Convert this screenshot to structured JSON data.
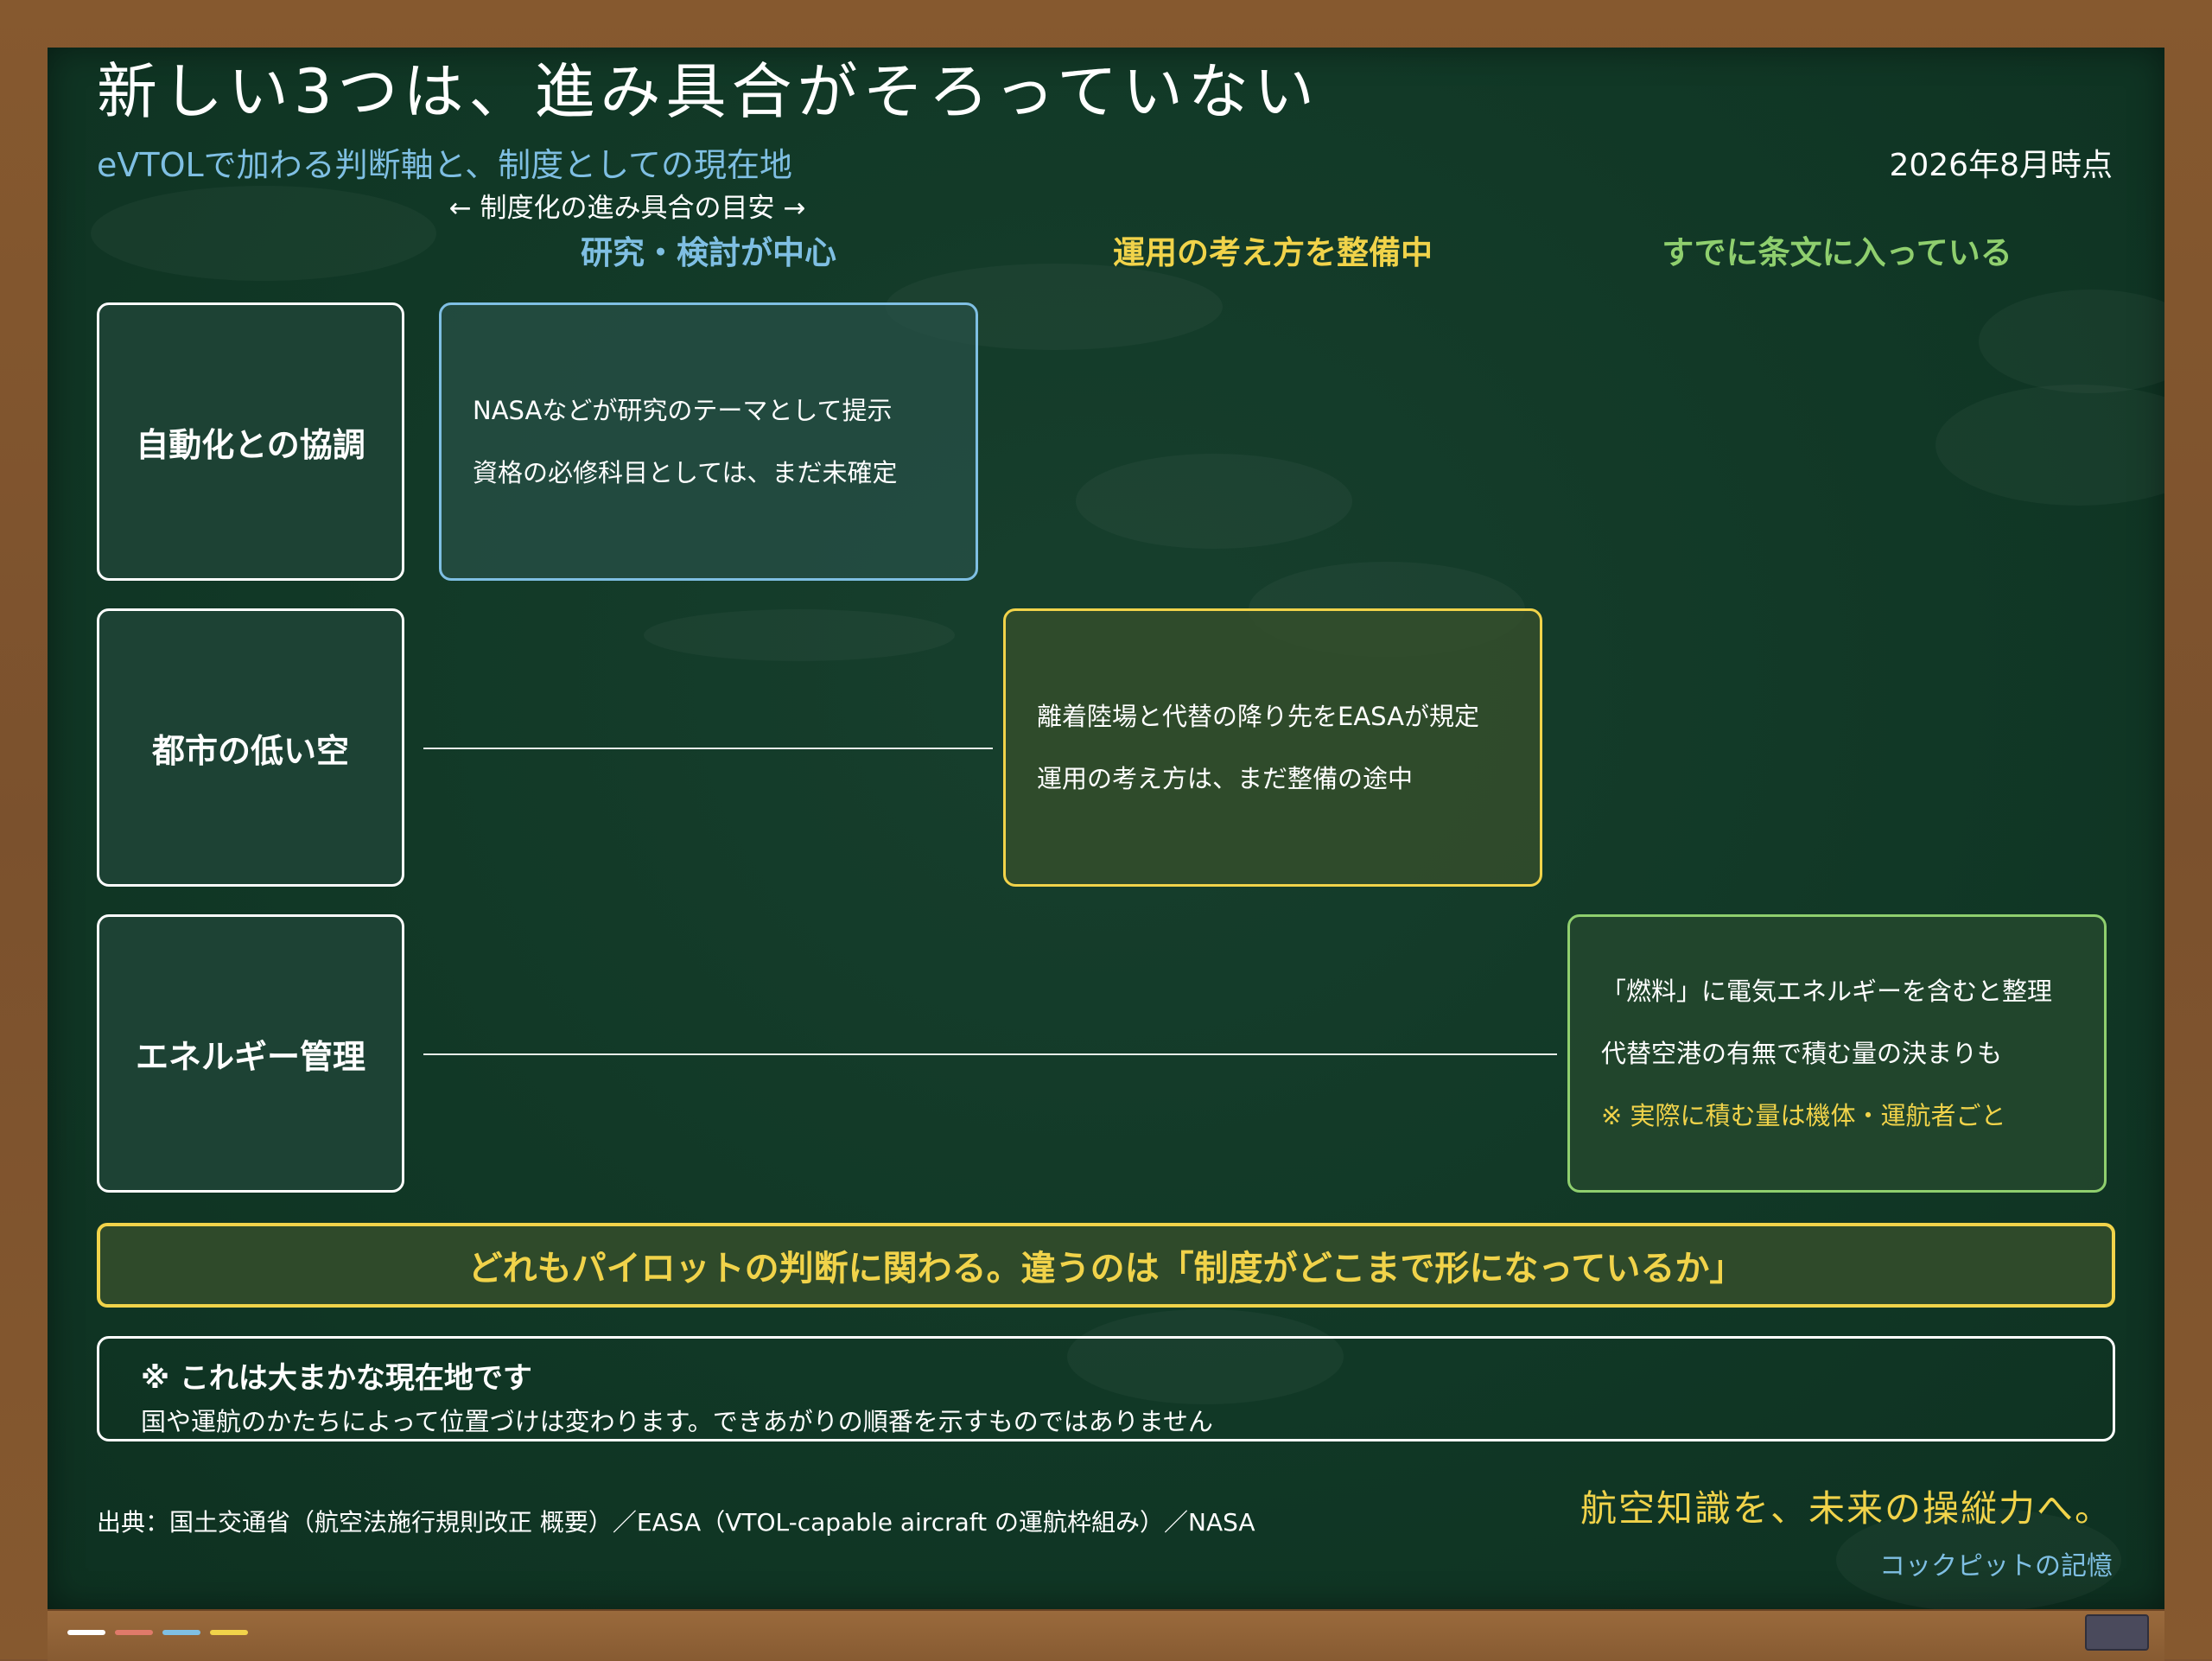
{
  "header": {
    "title": "新しい3つは、進み具合がそろっていない",
    "subtitle": "eVTOLで加わる判断軸と、制度としての現在地",
    "date": "2026年8月時点",
    "axis_hint": "← 制度化の進み具合の目安 →"
  },
  "columns": [
    {
      "label": "研究・検討が中心",
      "color": "#7fbfe3"
    },
    {
      "label": "運用の考え方を整備中",
      "color": "#f1d34a"
    },
    {
      "label": "すでに条文に入っている",
      "color": "#8fcf6e"
    }
  ],
  "rows": [
    {
      "label": "自動化との協調",
      "stage": 0,
      "lines": [
        "NASAなどが研究のテーマとして提示",
        "資格の必修科目としては、まだ未確定"
      ],
      "note": ""
    },
    {
      "label": "都市の低い空",
      "stage": 1,
      "lines": [
        "離着陸場と代替の降り先をEASAが規定",
        "運用の考え方は、まだ整備の途中"
      ],
      "note": ""
    },
    {
      "label": "エネルギー管理",
      "stage": 2,
      "lines": [
        "「燃料」に電気エネルギーを含むと整理",
        "代替空港の有無で積む量の決まりも"
      ],
      "note": "※ 実際に積む量は機体・運航者ごと"
    }
  ],
  "banner": "どれもパイロットの判断に関わる。違うのは「制度がどこまで形になっているか」",
  "caveat": {
    "title": "※ これは大まかな現在地です",
    "body": "国や運航のかたちによって位置づけは変わります。できあがりの順番を示すものではありません"
  },
  "footer": {
    "source": "出典：国土交通省（航空法施行規則改正 概要）／EASA（VTOL-capable aircraft の運航枠組み）／NASA",
    "slogan": "航空知識を、未来の操縦力へ。",
    "brand": "コックピットの記憶"
  },
  "colors": {
    "board": "#113826",
    "frame": "#7d5330",
    "stage_research": "#7fbfe3",
    "stage_developing": "#f1d34a",
    "stage_codified": "#8fcf6e",
    "text": "#ffffff"
  }
}
